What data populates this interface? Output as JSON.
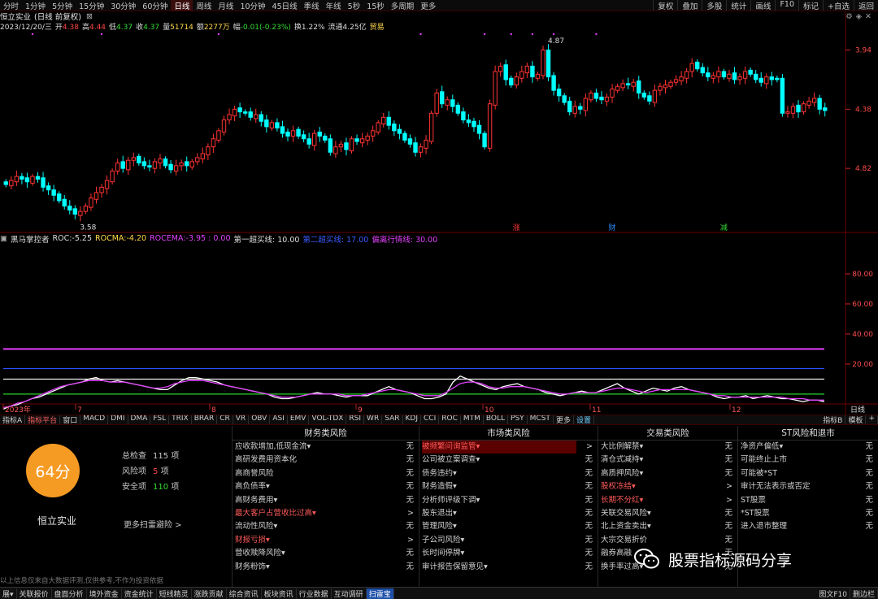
{
  "toolbar": {
    "left_items": [
      "分时",
      "1分钟",
      "5分钟",
      "15分钟",
      "30分钟",
      "60分钟",
      "日线",
      "周线",
      "月线",
      "10分钟",
      "45日线",
      "季线",
      "年线",
      "5秒",
      "15秒",
      "多周期",
      "更多"
    ],
    "active": "日线",
    "right_items": [
      "复权",
      "叠加",
      "多股",
      "统计",
      "画线",
      "F10",
      "标记",
      "+自选",
      "返回"
    ]
  },
  "title": {
    "stock": "恒立实业",
    "period": "(日线 前复权)"
  },
  "quote": {
    "date": "2023/12/20/三",
    "open_label": "开",
    "open": "4.38",
    "high_label": "高",
    "high": "4.44",
    "low_label": "低",
    "low": "4.37",
    "close_label": "收",
    "close": "4.37",
    "volume_label": "量",
    "volume": "51714",
    "amount_label": "额",
    "amount": "2277万",
    "change_label": "幅",
    "change": "-0.01(-0.23%)",
    "turnover_label": "换",
    "turnover": "1.22%",
    "float_label": "流通",
    "float": "4.25亿",
    "trade_label": "贸易"
  },
  "price_axis": [
    "4.82",
    "4.38",
    "3.94"
  ],
  "markers": {
    "high": "4.87",
    "low": "3.58",
    "events": [
      "涨",
      "财",
      "减"
    ]
  },
  "indicator": {
    "name": "黑马掌控者",
    "roc_label": "ROC:",
    "roc": "-5.25",
    "rocma_label": "ROCMA:",
    "rocma": "-4.20",
    "rocema_label": "ROCEMA:",
    "rocema": "-3.95 : 0.00",
    "l1": "第一超买线: 10.00",
    "l2": "第二超买线: 17.00",
    "l3": "偏离行情线: 30.00"
  },
  "indi_axis": [
    "80.00",
    "60.00",
    "40.00",
    "20.00"
  ],
  "x_axis": {
    "labels": [
      "2023年",
      "7",
      "8",
      "9",
      "10",
      "11",
      "12"
    ],
    "period": "日线"
  },
  "tabs": {
    "items": [
      "指标A",
      "指标平台",
      "窗口",
      "MACD",
      "DMI",
      "DMA",
      "FSL",
      "TRIX",
      "BRAR",
      "CR",
      "VR",
      "OBV",
      "ASI",
      "EMV",
      "VOL-TDX",
      "RSI",
      "WR",
      "SAR",
      "KDJ",
      "CCI",
      "ROC",
      "MTM",
      "BOLL",
      "PSY",
      "MCST",
      "更多",
      "设置"
    ],
    "right": [
      "指标B",
      "模板",
      "+"
    ]
  },
  "risk": {
    "score": "64分",
    "company": "恒立实业",
    "total_label": "总检查",
    "total": "115",
    "risk_label": "风险项",
    "risk": "5",
    "safe_label": "安全项",
    "safe": "110",
    "unit": "项",
    "more": "更多扫雷避险 >",
    "disclaimer": "以上信息仅来自大数据评测,仅供参考,不作为投资依据",
    "columns": [
      {
        "title": "财务类风险",
        "rows": [
          {
            "name": "应收款增加,低现金流▾",
            "status": "无"
          },
          {
            "name": "高研发费用资本化",
            "status": "无"
          },
          {
            "name": "高商誉风险",
            "status": "无"
          },
          {
            "name": "高负债率▾",
            "status": "无"
          },
          {
            "name": "高财务费用▾",
            "status": "无"
          },
          {
            "name": "最大客户占营收比过高▾",
            "status": ">"
          },
          {
            "name": "流动性风险▾",
            "status": "无"
          },
          {
            "name": "财报亏损▾",
            "status": ">"
          },
          {
            "name": "营收赎降风险▾",
            "status": "无"
          },
          {
            "name": "财务粉饰▾",
            "status": "无"
          }
        ]
      },
      {
        "title": "市场类风险",
        "rows": [
          {
            "name": "被频繁问询监管▾",
            "status": ">"
          },
          {
            "name": "公司被立案调查▾",
            "status": "无"
          },
          {
            "name": "债务违约▾",
            "status": "无"
          },
          {
            "name": "财务造假▾",
            "status": "无"
          },
          {
            "name": "分析师评级下调▾",
            "status": "无"
          },
          {
            "name": "股东退出▾",
            "status": "无"
          },
          {
            "name": "管理风险▾",
            "status": "无"
          },
          {
            "name": "子公司风险▾",
            "status": "无"
          },
          {
            "name": "长时间停牌▾",
            "status": "无"
          },
          {
            "name": "审计报告保留意见▾",
            "status": "无"
          }
        ]
      },
      {
        "title": "交易类风险",
        "rows": [
          {
            "name": "大比例解禁▾",
            "status": "无"
          },
          {
            "name": "清仓式减持▾",
            "status": "无"
          },
          {
            "name": "高质押风险▾",
            "status": "无"
          },
          {
            "name": "股权冻结▾",
            "status": ">"
          },
          {
            "name": "长期不分红▾",
            "status": ">"
          },
          {
            "name": "关联交易风险▾",
            "status": "无"
          },
          {
            "name": "北上资金卖出▾",
            "status": "无"
          },
          {
            "name": "大宗交易折价",
            "status": "无"
          },
          {
            "name": "融券高融",
            "status": "无"
          },
          {
            "name": "换手率过高▾",
            "status": "无"
          }
        ]
      },
      {
        "title": "ST风险和退市",
        "rows": [
          {
            "name": "净资产偏低▾",
            "status": "无"
          },
          {
            "name": "可能终止上市",
            "status": "无"
          },
          {
            "name": "可能被*ST",
            "status": "无"
          },
          {
            "name": "审计无法表示或否定",
            "status": "无"
          },
          {
            "name": "ST股票",
            "status": "无"
          },
          {
            "name": "*ST股票",
            "status": "无"
          },
          {
            "name": "进入退市整理",
            "status": "无"
          },
          {
            "name": "",
            "status": ""
          },
          {
            "name": "",
            "status": ""
          },
          {
            "name": "",
            "status": ""
          }
        ]
      }
    ]
  },
  "bottom": {
    "items": [
      "展▾",
      "关联报价",
      "盘面分析",
      "境外资金",
      "资金统计",
      "短线精灵",
      "涨跌贡献",
      "综合资讯",
      "板块资讯",
      "行业数据",
      "互动调研",
      "扫雷宝"
    ],
    "active": "扫雷宝",
    "right": [
      "图文F10",
      "删边栏"
    ]
  },
  "watermark": "股票指标源码分享",
  "colors": {
    "up": "#ff3333",
    "down": "#00ffff",
    "grid": "#6b0000",
    "purple": "#e040fb",
    "blue": "#2b50ff",
    "green": "#2bd52b",
    "white": "#ffffff",
    "orange": "#f59a23"
  },
  "chart_data": [
    {
      "type": "candlestick",
      "title": "恒立实业 (日线 前复权)",
      "ylim": [
        3.5,
        4.95
      ],
      "y_ticks": [
        3.94,
        4.38,
        4.82
      ],
      "x_labels": [
        "2023年",
        "7",
        "8",
        "9",
        "10",
        "11",
        "12"
      ],
      "closes": [
        3.82,
        3.85,
        3.88,
        3.86,
        3.84,
        3.88,
        3.86,
        3.8,
        3.78,
        3.74,
        3.7,
        3.66,
        3.63,
        3.6,
        3.62,
        3.66,
        3.72,
        3.76,
        3.8,
        3.85,
        3.92,
        3.98,
        3.94,
        4.0,
        4.02,
        3.98,
        3.96,
        3.95,
        3.99,
        4.01,
        3.96,
        3.93,
        3.96,
        3.98,
        3.96,
        3.99,
        4.02,
        4.05,
        4.1,
        4.16,
        4.22,
        4.3,
        4.34,
        4.38,
        4.36,
        4.35,
        4.32,
        4.34,
        4.29,
        4.25,
        4.28,
        4.24,
        4.2,
        4.18,
        4.22,
        4.18,
        4.16,
        4.12,
        4.2,
        4.18,
        4.15,
        4.06,
        4.1,
        4.12,
        4.08,
        4.16,
        4.14,
        4.16,
        4.18,
        4.22,
        4.28,
        4.32,
        4.26,
        4.22,
        4.2,
        4.15,
        4.12,
        4.06,
        4.1,
        4.15,
        4.35,
        4.5,
        4.42,
        4.45,
        4.4,
        4.35,
        4.3,
        4.28,
        4.25,
        4.2,
        4.1,
        4.42,
        4.66,
        4.7,
        4.6,
        4.56,
        4.62,
        4.66,
        4.7,
        4.62,
        4.64,
        4.82,
        4.62,
        4.52,
        4.48,
        4.43,
        4.36,
        4.4,
        4.38,
        4.46,
        4.5,
        4.46,
        4.45,
        4.47,
        4.53,
        4.55,
        4.57,
        4.56,
        4.58,
        4.5,
        4.47,
        4.44,
        4.52,
        4.55,
        4.56,
        4.58,
        4.6,
        4.62,
        4.66,
        4.72,
        4.68,
        4.65,
        4.62,
        4.63,
        4.66,
        4.62,
        4.64,
        4.6,
        4.62,
        4.66,
        4.64,
        4.6,
        4.58,
        4.62,
        4.6,
        4.6,
        4.35,
        4.36,
        4.4,
        4.36,
        4.42,
        4.44,
        4.46,
        4.38,
        4.37
      ]
    },
    {
      "type": "line",
      "title": "黑马掌控者",
      "ylim": [
        -6,
        100
      ],
      "y_ticks": [
        20,
        40,
        60,
        80
      ],
      "hlines": [
        {
          "name": "偏离行情线",
          "value": 30,
          "color": "#e040fb"
        },
        {
          "name": "第二超买线",
          "value": 17,
          "color": "#2b50ff"
        },
        {
          "name": "第一超买线",
          "value": 10,
          "color": "#ffffff"
        },
        {
          "name": "zero",
          "value": 0,
          "color": "#2bd52b"
        }
      ],
      "series": [
        {
          "name": "ROC",
          "color": "#ffffff",
          "values": [
            -10,
            -8,
            -7,
            -5,
            -3,
            -2,
            0,
            2,
            4,
            6,
            7,
            8,
            10,
            11,
            9,
            8,
            9,
            8,
            7,
            6,
            5,
            4,
            3,
            3,
            6,
            9,
            11,
            11,
            10,
            9,
            8,
            6,
            5,
            4,
            3,
            2,
            1,
            0,
            -2,
            -3,
            -3,
            -2,
            -1,
            0,
            1,
            0,
            0,
            -1,
            -2,
            -1,
            -1,
            -1,
            1,
            3,
            5,
            3,
            2,
            1,
            -1,
            -3,
            -3,
            -2,
            0,
            8,
            12,
            10,
            8,
            6,
            4,
            3,
            5,
            6,
            7,
            5,
            4,
            3,
            1,
            0,
            -1,
            0,
            1,
            2,
            1,
            1,
            3,
            5,
            7,
            4,
            2,
            0,
            2,
            4,
            3,
            2,
            4,
            5,
            3,
            2,
            1,
            0,
            -2,
            -3,
            -2,
            -2,
            -1,
            -3,
            -2,
            -1,
            -2,
            -3,
            -3,
            -4,
            -5,
            -4,
            -4,
            -5
          ]
        },
        {
          "name": "ROCMA",
          "color": "#e040fb",
          "values": [
            -9,
            -8,
            -6,
            -5,
            -3,
            -1,
            1,
            3,
            5,
            6,
            7,
            8,
            9,
            9,
            9,
            8,
            8,
            8,
            7,
            6,
            5,
            4,
            4,
            5,
            7,
            8,
            9,
            9,
            9,
            8,
            7,
            6,
            5,
            4,
            3,
            2,
            1,
            0,
            -1,
            -2,
            -2,
            -2,
            -1,
            0,
            0,
            0,
            0,
            0,
            -1,
            -1,
            -1,
            0,
            1,
            2,
            3,
            3,
            2,
            1,
            0,
            -1,
            -1,
            -1,
            1,
            4,
            7,
            8,
            8,
            7,
            5,
            4,
            4,
            5,
            5,
            5,
            4,
            3,
            2,
            1,
            0,
            0,
            1,
            1,
            1,
            1,
            2,
            3,
            4,
            4,
            3,
            2,
            1,
            2,
            3,
            3,
            3,
            3,
            3,
            2,
            1,
            0,
            -1,
            -1,
            -2,
            -2,
            -2,
            -2,
            -2,
            -2,
            -2,
            -2,
            -3,
            -3,
            -3,
            -4,
            -4,
            -4
          ]
        }
      ]
    }
  ]
}
